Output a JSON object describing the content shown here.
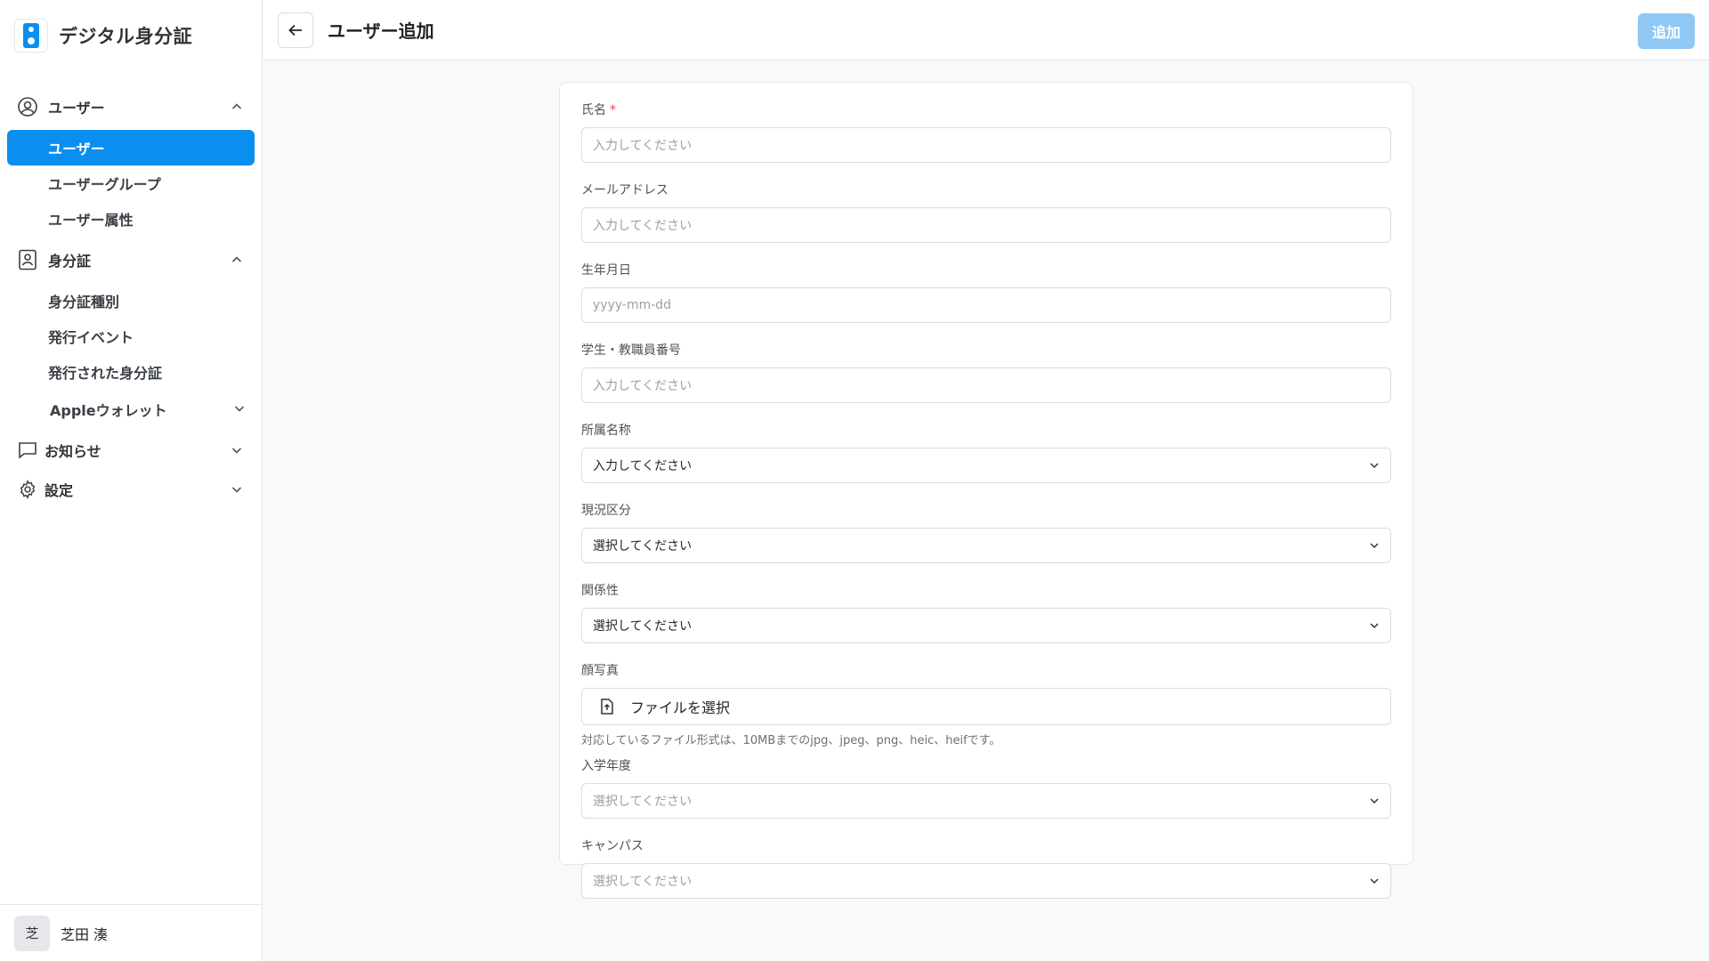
{
  "app": {
    "name": "デジタル身分証"
  },
  "sidebar": {
    "groups": [
      {
        "label": "ユーザー",
        "icon": "user-circle-icon",
        "expanded": true,
        "items": [
          {
            "label": "ユーザー",
            "active": true
          },
          {
            "label": "ユーザーグループ"
          },
          {
            "label": "ユーザー属性"
          }
        ]
      },
      {
        "label": "身分証",
        "icon": "id-badge-icon",
        "expanded": true,
        "items": [
          {
            "label": "身分証種別"
          },
          {
            "label": "発行イベント"
          },
          {
            "label": "発行された身分証"
          },
          {
            "label": "Appleウォレット"
          }
        ]
      },
      {
        "label": "お知らせ",
        "icon": "chat-bubble-icon",
        "expanded": false
      },
      {
        "label": "設定",
        "icon": "gear-icon",
        "expanded": false
      }
    ],
    "user": {
      "avatar_text": "芝",
      "name": "芝田 湊"
    }
  },
  "header": {
    "title": "ユーザー追加",
    "add_label": "追加"
  },
  "form": {
    "name": {
      "label": "氏名",
      "required_mark": "*",
      "placeholder": "入力してください"
    },
    "email": {
      "label": "メールアドレス",
      "placeholder": "入力してください"
    },
    "birthdate": {
      "label": "生年月日",
      "placeholder": "yyyy-mm-dd"
    },
    "student_id": {
      "label": "学生・教職員番号",
      "placeholder": "入力してください"
    },
    "affiliation": {
      "label": "所属名称",
      "value": "入力してください"
    },
    "status": {
      "label": "現況区分",
      "value": "選択してください"
    },
    "relation": {
      "label": "関係性",
      "value": "選択してください"
    },
    "photo": {
      "label": "顔写真",
      "button": "ファイルを選択",
      "hint": "対応しているファイル形式は、10MBまでのjpg、jpeg、png、heic、heifです。"
    },
    "enroll_year": {
      "label": "入学年度",
      "value": "選択してください"
    },
    "campus": {
      "label": "キャンパス",
      "value": "選択してください"
    }
  },
  "colors": {
    "accent": "#0a8ef0",
    "add_button_disabled": "#8fc7f5",
    "required": "#e5484d"
  }
}
